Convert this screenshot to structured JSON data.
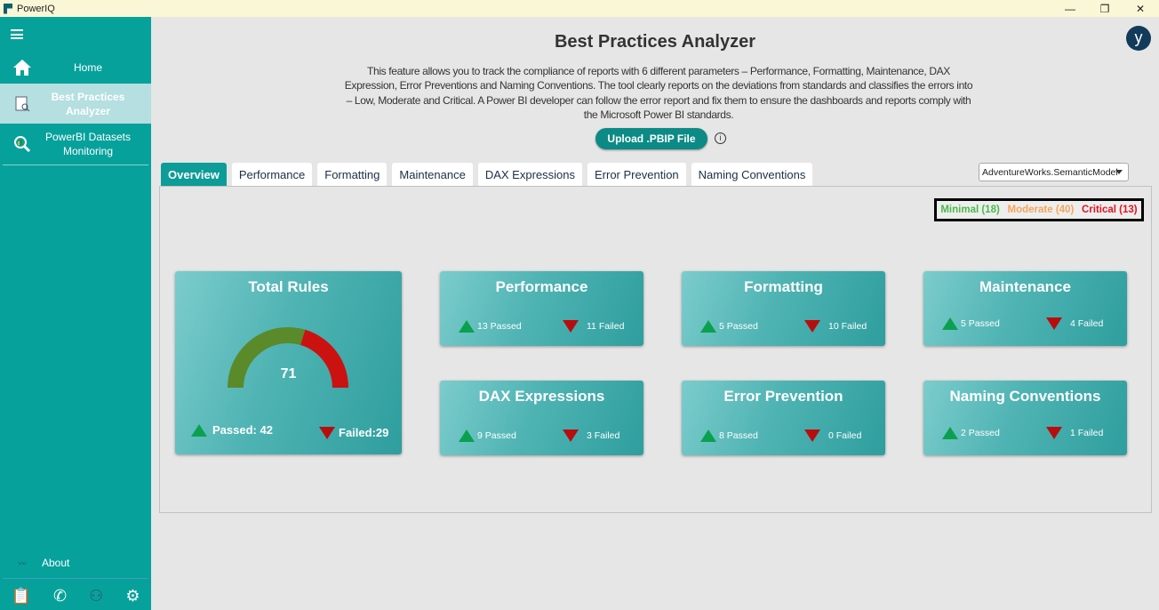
{
  "app": {
    "title": "PowerIQ",
    "window_controls": {
      "minimize": "—",
      "restore": "❐",
      "close": "✕"
    }
  },
  "sidebar": {
    "items": [
      {
        "label": "Home",
        "icon": "home-icon"
      },
      {
        "label": "Best Practices Analyzer",
        "icon": "analyzer-report-icon",
        "active": true
      },
      {
        "label": "PowerBI Datasets Monitoring",
        "icon": "magnifier-chart-icon"
      }
    ],
    "about": "About",
    "bottom_icons": [
      "clipboard-check-icon",
      "phone-mail-icon",
      "team-icon",
      "gear-icon"
    ]
  },
  "header": {
    "title": "Best Practices Analyzer",
    "avatar": "y",
    "description": "This feature allows you to track the compliance of reports with 6 different parameters – Performance, Formatting, Maintenance, DAX Expression, Error Preventions and Naming Conventions. The tool clearly reports on the deviations from standards and classifies the errors into – Low, Moderate and Critical. A Power BI developer can follow the error report and fix them to ensure the dashboards and reports comply with the Microsoft Power BI standards.",
    "upload_label": "Upload .PBIP File",
    "info": "i"
  },
  "tabs": [
    "Overview",
    "Performance",
    "Formatting",
    "Maintenance",
    "DAX Expressions",
    "Error Prevention",
    "Naming Conventions"
  ],
  "active_tab": "Overview",
  "model_select": {
    "value": "AdventureWorks.SemanticModel"
  },
  "legend": [
    {
      "label": "Minimal (18)",
      "color": "#4cb84c"
    },
    {
      "label": "Moderate (40)",
      "color": "#f5a55a"
    },
    {
      "label": "Critical (13)",
      "color": "#e3141e"
    }
  ],
  "total": {
    "title": "Total Rules",
    "value": "71",
    "passed": 42,
    "failed": 29,
    "passed_label": "Passed: 42",
    "failed_label": "Failed:29",
    "colors": {
      "passed": "#5a8a2a",
      "failed": "#cc1111"
    }
  },
  "cards": [
    {
      "title": "Performance",
      "passed": "13 Passed",
      "failed": "11 Failed"
    },
    {
      "title": "Formatting",
      "passed": "5 Passed",
      "failed": "10 Failed"
    },
    {
      "title": "Maintenance",
      "passed": "5 Passed",
      "failed": "4 Failed"
    },
    {
      "title": "DAX Expressions",
      "passed": "9 Passed",
      "failed": "3 Failed"
    },
    {
      "title": "Error Prevention",
      "passed": "8 Passed",
      "failed": "0 Failed"
    },
    {
      "title": "Naming Conventions",
      "passed": "2 Passed",
      "failed": "1 Failed"
    }
  ]
}
